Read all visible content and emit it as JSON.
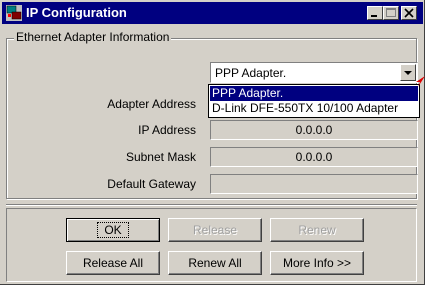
{
  "window": {
    "title": "IP Configuration",
    "icon": "network-config-icon",
    "controls": [
      "minimize-icon",
      "maximize-icon",
      "close-icon"
    ]
  },
  "group": {
    "title": "Ethernet Adapter Information"
  },
  "adapter_combo": {
    "selected": "PPP Adapter.",
    "options": [
      "PPP Adapter.",
      "D-Link DFE-550TX 10/100 Adapter"
    ]
  },
  "fields": {
    "adapter_address_label": "Adapter Address",
    "ip_address_label": "IP Address",
    "ip_address_value": "0.0.0.0",
    "subnet_mask_label": "Subnet Mask",
    "subnet_mask_value": "0.0.0.0",
    "default_gateway_label": "Default Gateway",
    "default_gateway_value": ""
  },
  "buttons": {
    "ok": "OK",
    "release": "Release",
    "renew": "Renew",
    "release_all": "Release All",
    "renew_all": "Renew All",
    "more_info": "More Info >>"
  },
  "colors": {
    "titlebar": "#000080",
    "face": "#d4d0c8",
    "selection": "#000080"
  }
}
